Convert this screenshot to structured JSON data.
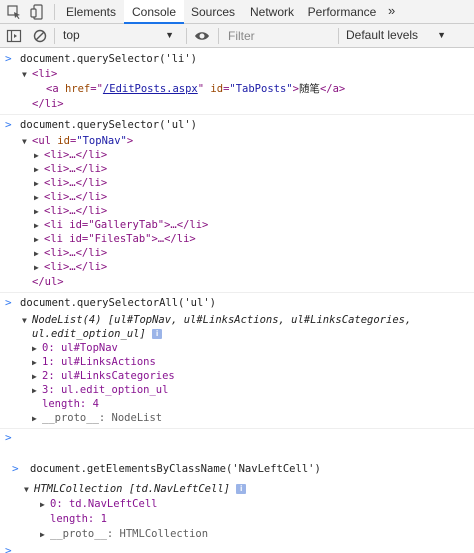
{
  "tabs": [
    "Elements",
    "Console",
    "Sources",
    "Network",
    "Performance"
  ],
  "more_icon": "»",
  "toolbar": {
    "context": "top",
    "filter_placeholder": "Filter",
    "levels": "Default levels"
  },
  "accent": "#1a73e8",
  "console": {
    "cmd1": "document.querySelector('li')",
    "out1_open": "<li>",
    "out1_a_tag": "<a ",
    "out1_href_attr": "href",
    "out1_href_val": "/EditPosts.aspx",
    "out1_id_attr": "id",
    "out1_id_val": "\"TabPosts\"",
    "out1_text": "随笔",
    "out1_a_close": "</a>",
    "out1_close": "</li>",
    "cmd2": "document.querySelector('ul')",
    "out2_open_tag": "<ul ",
    "out2_id_attr": "id",
    "out2_id_val": "\"TopNav\"",
    "out2_items": [
      "<li>…</li>",
      "<li>…</li>",
      "<li>…</li>",
      "<li>…</li>",
      "<li>…</li>",
      "<li id=\"GalleryTab\">…</li>",
      "<li id=\"FilesTab\">…</li>",
      "<li>…</li>",
      "<li>…</li>"
    ],
    "out2_close": "</ul>",
    "cmd3": "document.querySelectorAll('ul')",
    "out3_summary": "NodeList(4) [ul#TopNav, ul#LinksActions, ul#LinksCategories,",
    "out3_summary2": "ul.edit_option_ul]",
    "out3_items": [
      "0: ul#TopNav",
      "1: ul#LinksActions",
      "2: ul#LinksCategories",
      "3: ul.edit_option_ul"
    ],
    "out3_length": "length: 4",
    "out3_proto": "__proto__: NodeList",
    "cmd4": "document.getElementsByClassName('NavLeftCell')",
    "out4_summary": "HTMLCollection [td.NavLeftCell]",
    "out4_item": "0: td.NavLeftCell",
    "out4_length": "length: 1",
    "out4_proto": "__proto__: HTMLCollection",
    "info_badge": "i",
    "prompt": ">"
  }
}
